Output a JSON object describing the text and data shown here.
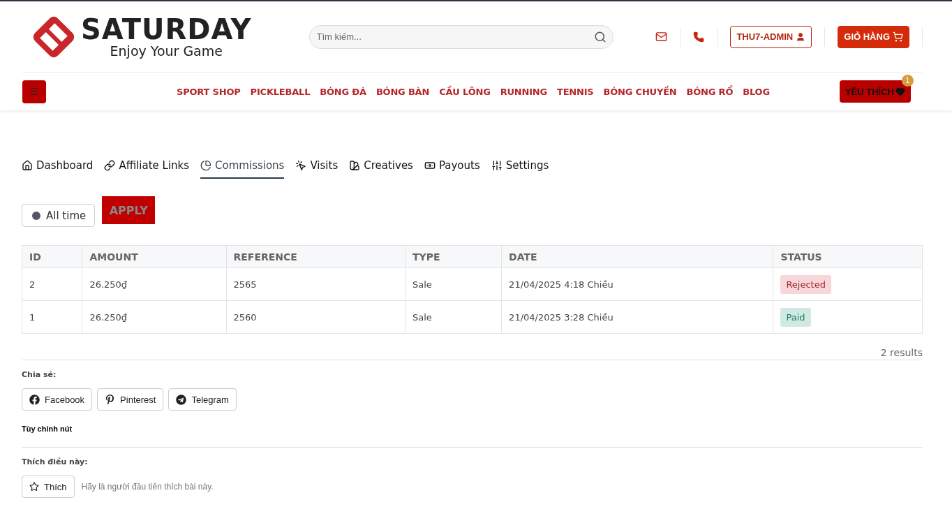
{
  "header": {
    "logo": {
      "name": "SATURDAY",
      "tagline": "Enjoy Your Game"
    },
    "search": {
      "placeholder": "Tìm kiếm..."
    },
    "account": "THU7-ADMIN",
    "cart": "GIỎ HÀNG"
  },
  "nav": {
    "items": [
      "SPORT SHOP",
      "PICKLEBALL",
      "BÓNG ĐÁ",
      "BÓNG BÀN",
      "CẦU LÔNG",
      "RUNNING",
      "TENNIS",
      "BÓNG CHUYỀN",
      "BÓNG RỔ",
      "BLOG"
    ],
    "wishlist": {
      "label": "YÊU THÍCH",
      "count": "1"
    }
  },
  "tabs": [
    {
      "label": "Dashboard",
      "selected": false
    },
    {
      "label": "Affiliate Links",
      "selected": false
    },
    {
      "label": "Commissions",
      "selected": true
    },
    {
      "label": "Visits",
      "selected": false
    },
    {
      "label": "Creatives",
      "selected": false
    },
    {
      "label": "Payouts",
      "selected": false
    },
    {
      "label": "Settings",
      "selected": false
    }
  ],
  "filter": {
    "range": "All time",
    "apply": "APPLY"
  },
  "table": {
    "columns": [
      "ID",
      "AMOUNT",
      "REFERENCE",
      "TYPE",
      "DATE",
      "STATUS"
    ],
    "rows": [
      {
        "cells": [
          "2",
          "26.250₫",
          "2565",
          "Sale",
          "21/04/2025 4:18 Chiều"
        ],
        "status": {
          "label": "Rejected",
          "kind": "rejected"
        }
      },
      {
        "cells": [
          "1",
          "26.250₫",
          "2560",
          "Sale",
          "21/04/2025 3:28 Chiều"
        ],
        "status": {
          "label": "Paid",
          "kind": "paid"
        }
      }
    ],
    "results": "2 results"
  },
  "share": {
    "heading": "Chia sẻ:",
    "buttons": [
      "Facebook",
      "Pinterest",
      "Telegram"
    ],
    "customize": "Tùy chỉnh nút"
  },
  "like": {
    "heading": "Thích điều này:",
    "button": "Thích",
    "note": "Hãy là người đầu tiên thích bài này."
  }
}
